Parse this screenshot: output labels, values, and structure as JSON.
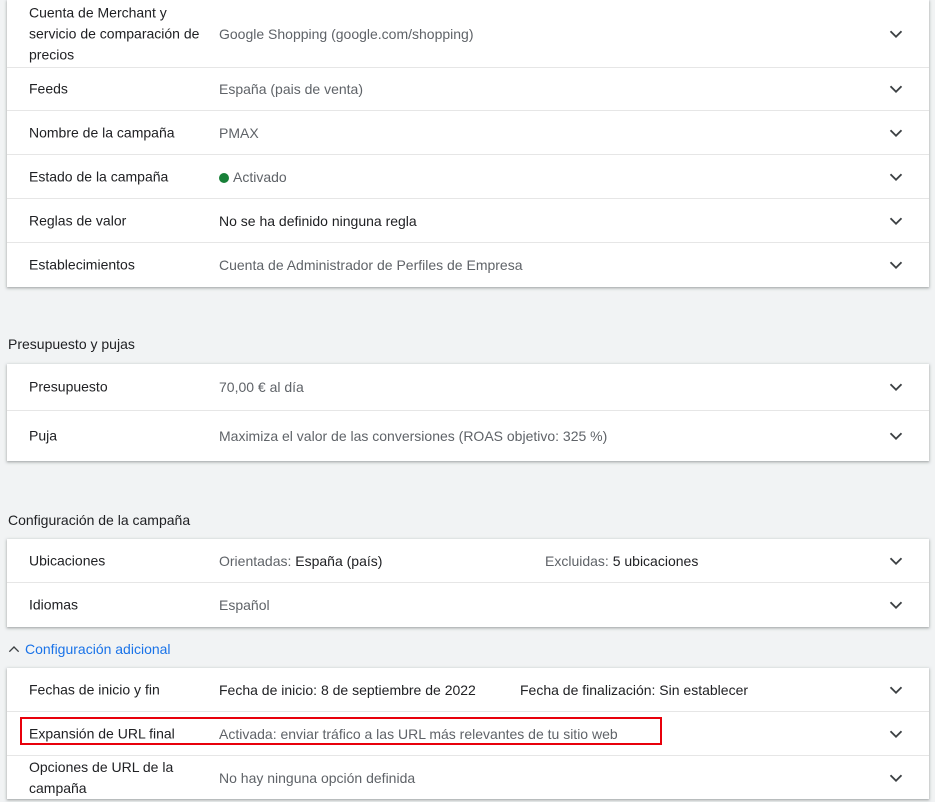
{
  "general": {
    "merchant": {
      "label": "Cuenta de Merchant y servicio de comparación de precios",
      "value": "Google Shopping (google.com/shopping)"
    },
    "feeds": {
      "label": "Feeds",
      "value": "España (pais de venta)"
    },
    "name": {
      "label": "Nombre de la campaña",
      "value": "PMAX"
    },
    "status": {
      "label": "Estado de la campaña",
      "value": "Activado",
      "color": "#188038"
    },
    "value_rules": {
      "label": "Reglas de valor",
      "value": "No se ha definido ninguna regla"
    },
    "locations": {
      "label": "Establecimientos",
      "value": "Cuenta de Administrador de Perfiles de Empresa"
    }
  },
  "budget_section": {
    "title": "Presupuesto y pujas",
    "budget": {
      "label": "Presupuesto",
      "value": "70,00 € al día"
    },
    "bid": {
      "label": "Puja",
      "value": "Maximiza el valor de las conversiones (ROAS objetivo: 325 %)"
    }
  },
  "config_section": {
    "title": "Configuración de la campaña",
    "locations": {
      "label": "Ubicaciones",
      "targeted_label": "Orientadas:",
      "targeted_value": "España (país)",
      "excluded_label": "Excluidas:",
      "excluded_value": "5 ubicaciones"
    },
    "languages": {
      "label": "Idiomas",
      "value": "Español"
    }
  },
  "additional": {
    "toggle_label": "Configuración adicional",
    "dates": {
      "label": "Fechas de inicio y fin",
      "start": "Fecha de inicio: 8 de septiembre de 2022",
      "end": "Fecha de finalización: Sin establecer"
    },
    "url_expansion": {
      "label": "Expansión de URL final",
      "value": "Activada: enviar tráfico a las URL más relevantes de tu sitio web",
      "highlight_color": "#e8000b"
    },
    "url_options": {
      "label": "Opciones de URL de la campaña",
      "value": "No hay ninguna opción definida"
    }
  },
  "icons": {
    "expand": "chevron-down-icon",
    "collapse": "chevron-up-icon"
  },
  "accent": "#1a73e8"
}
